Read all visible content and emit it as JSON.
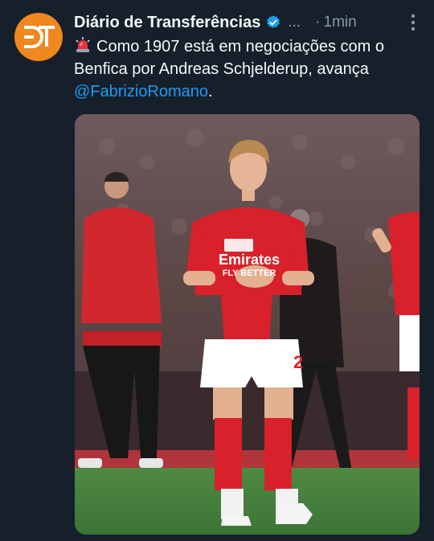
{
  "tweet": {
    "author_name": "Diário de Transferências",
    "ellipsis": "...",
    "separator": "·",
    "time": "1min",
    "text_main": "Como 1907 está em negociações com o Benfica por Andreas Schjelderup, avança ",
    "mention": "@FabrizioRomano",
    "text_end": ".",
    "avatar_letters": "DT",
    "media_sponsor": "Emirates",
    "media_sponsor2": "FLY BETTER",
    "media_number": "2"
  },
  "icons": {
    "verified": "verified-badge-icon",
    "more": "more-options-icon",
    "siren": "rotating-light-emoji-icon"
  },
  "colors": {
    "background": "#15202b",
    "text": "#f7f9f9",
    "muted": "#8b98a5",
    "link": "#1d9bf0",
    "avatar": "#f0871f",
    "benfica_red": "#d8212a"
  }
}
